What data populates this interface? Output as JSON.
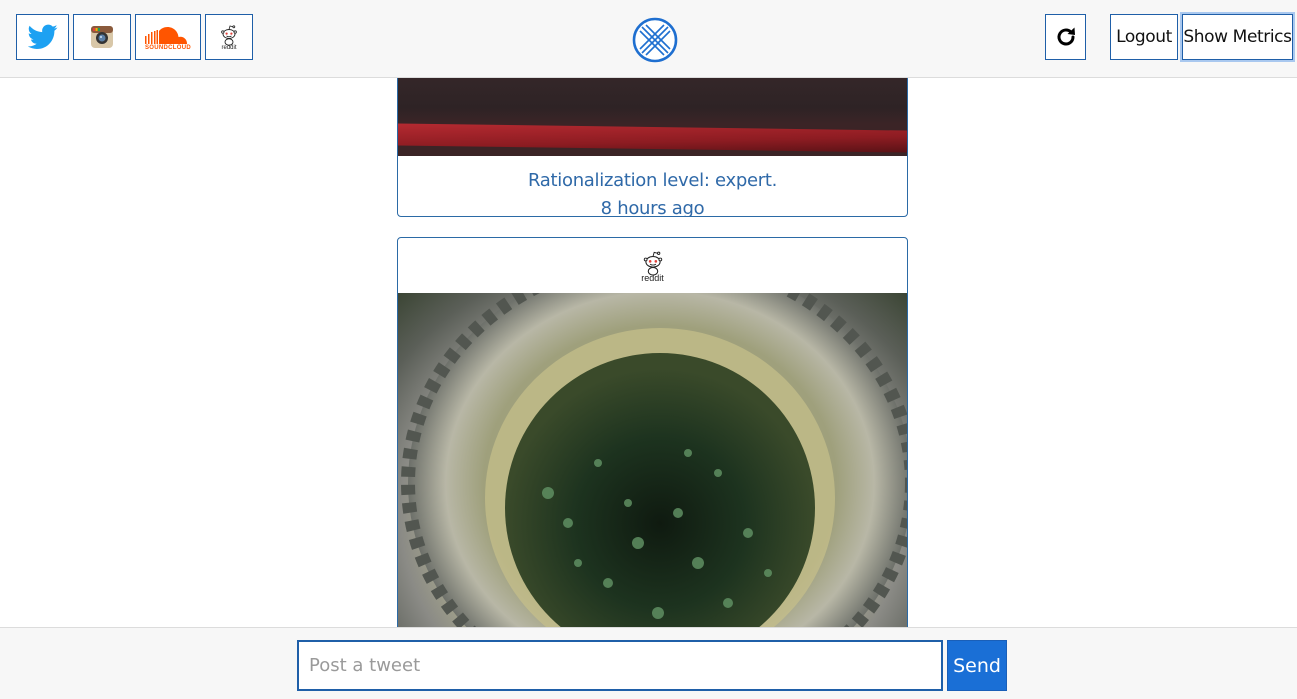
{
  "header": {
    "services": [
      {
        "name": "twitter",
        "icon": "twitter-bird-icon",
        "color": "#1da1f2"
      },
      {
        "name": "instagram",
        "icon": "instagram-camera-icon",
        "color": "#8a5a3c"
      },
      {
        "name": "soundcloud",
        "icon": "soundcloud-icon",
        "label": "SOUNDCLOUD",
        "color": "#ff5500"
      },
      {
        "name": "reddit",
        "icon": "reddit-alien-icon",
        "label": "reddit"
      }
    ],
    "logo_icon": "crossed-circle-logo-icon",
    "refresh_icon": "refresh-icon",
    "logout_label": "Logout",
    "metrics_label": "Show Metrics"
  },
  "feed": {
    "posts": [
      {
        "caption": "Rationalization level: expert.",
        "time": "8 hours ago"
      },
      {
        "source_label": "reddit",
        "source_icon": "reddit-alien-icon"
      }
    ]
  },
  "composer": {
    "placeholder": "Post a tweet",
    "value": "",
    "send_label": "Send",
    "accent": "#1a6fd6"
  }
}
